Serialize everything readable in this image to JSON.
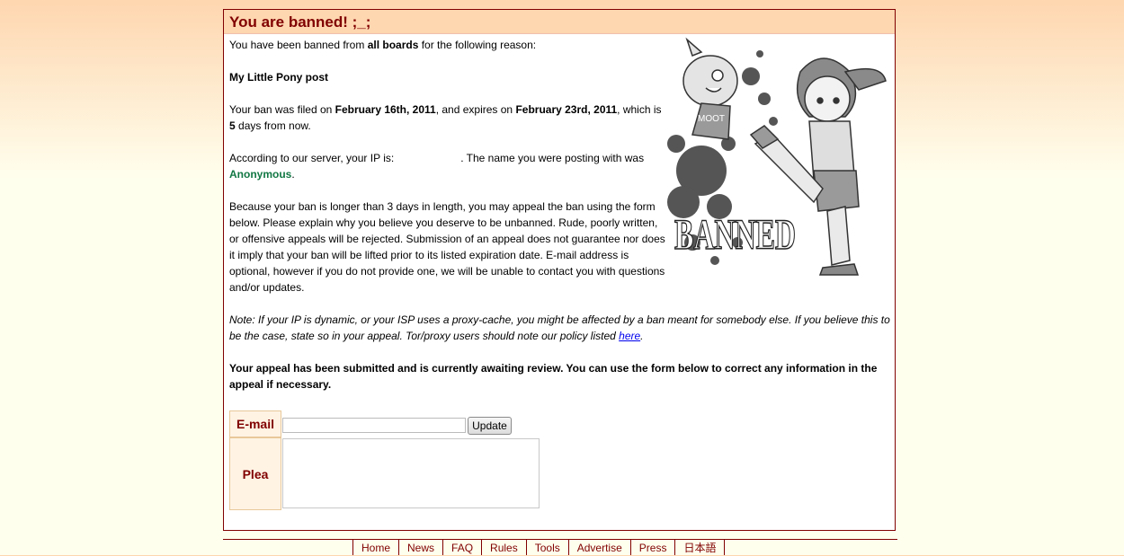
{
  "ban": {
    "title": "You are banned! ;_;",
    "intro_pre": "You have been banned from ",
    "boards": "all boards",
    "intro_post": " for the following reason:",
    "reason": "My Little Pony post",
    "filed_pre": "Your ban was filed on ",
    "filed_date": "February 16th, 2011",
    "expires_pre": ", and expires on ",
    "expires_date": "February 23rd, 2011",
    "which_is": ", which is ",
    "days": "5",
    "days_post": " days from now.",
    "ip_pre": "According to our server, your IP is:",
    "ip_post": ". The name you were posting with was",
    "name": "Anonymous",
    "appeal_text": "Because your ban is longer than 3 days in length, you may appeal the ban using the form below. Please explain why you believe you deserve to be unbanned. Rude, poorly written, or offensive appeals will be rejected. Submission of an appeal does not guarantee nor does it imply that your ban will be lifted prior to its listed expiration date. E-mail address is optional, however if you do not provide one, we will be unable to contact you with questions and/or updates.",
    "note": "Note: If your IP is dynamic, or your ISP uses a proxy-cache, you might be affected by a ban meant for somebody else. If you believe this to be the case, state so in your appeal. Tor/proxy users should note our policy listed ",
    "note_link": "here",
    "notice": "Your appeal has been submitted and is currently awaiting review. You can use the form below to correct any information in the appeal if necessary.",
    "banned_stamp": "BANNED",
    "shirt_text": "MOOT"
  },
  "form": {
    "email_label": "E-mail",
    "email_value": "",
    "update_label": "Update",
    "plea_label": "Plea",
    "plea_value": ""
  },
  "nav": [
    "Home",
    "News",
    "FAQ",
    "Rules",
    "Tools",
    "Advertise",
    "Press",
    "日本語"
  ]
}
